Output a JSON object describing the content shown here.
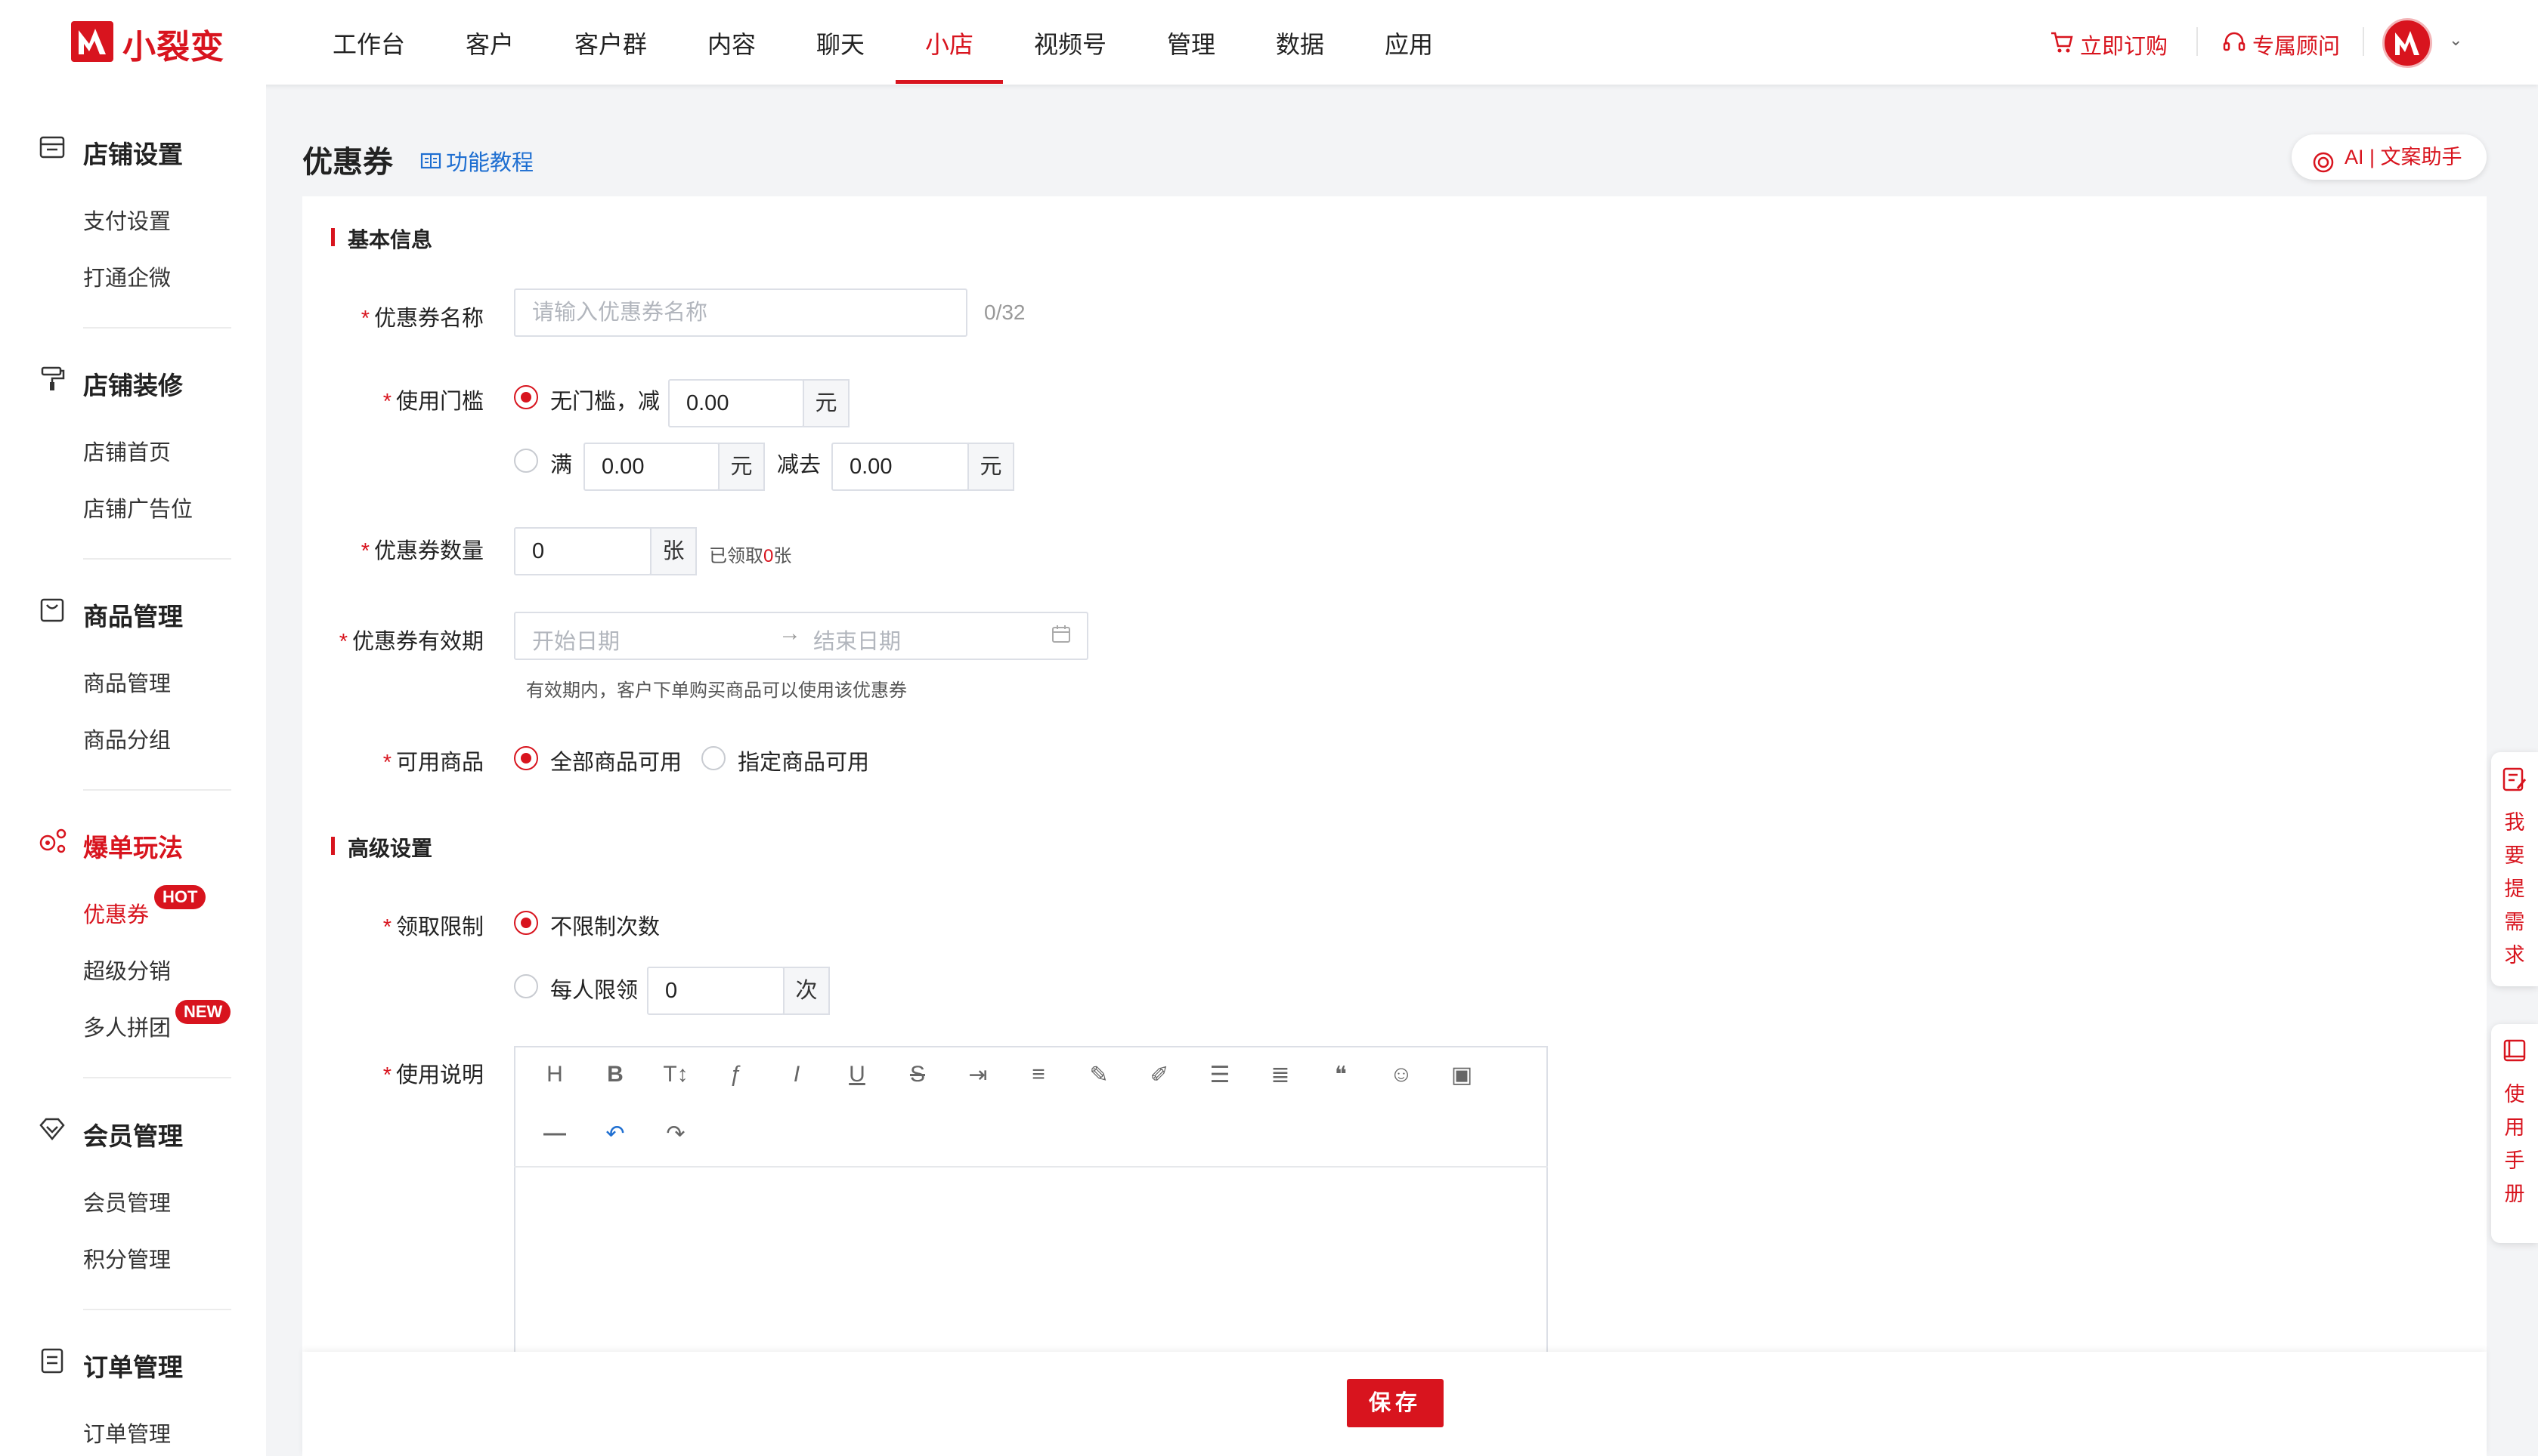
{
  "app": {
    "logo_text": "小裂变"
  },
  "nav": {
    "items": [
      "工作台",
      "客户",
      "客户群",
      "内容",
      "聊天",
      "小店",
      "视频号",
      "管理",
      "数据",
      "应用"
    ],
    "active": "小店"
  },
  "header_actions": {
    "order": "立即订购",
    "consultant": "专属顾问"
  },
  "sidebar": {
    "sections": [
      {
        "title": "店铺设置",
        "items": [
          "支付设置",
          "打通企微"
        ]
      },
      {
        "title": "店铺装修",
        "items": [
          "店铺首页",
          "店铺广告位"
        ]
      },
      {
        "title": "商品管理",
        "items": [
          "商品管理",
          "商品分组"
        ]
      },
      {
        "title": "爆单玩法",
        "items": [
          "优惠券",
          "超级分销",
          "多人拼团"
        ]
      },
      {
        "title": "会员管理",
        "items": [
          "会员管理",
          "积分管理"
        ]
      },
      {
        "title": "订单管理",
        "items": [
          "订单管理"
        ]
      }
    ],
    "badges": {
      "hot": "HOT",
      "new": "NEW"
    }
  },
  "page": {
    "title": "优惠券",
    "tutorial": "功能教程",
    "ai_button": "AI | 文案助手"
  },
  "basic": {
    "section_title": "基本信息",
    "name_label": "优惠券名称",
    "name_placeholder": "请输入优惠券名称",
    "name_counter": "0/32",
    "threshold_label": "使用门槛",
    "threshold_opt1": "无门槛，减",
    "threshold_opt1_value": "0.00",
    "threshold_opt2_prefix": "满",
    "threshold_opt2_value1": "0.00",
    "threshold_opt2_mid": "减去",
    "threshold_opt2_value2": "0.00",
    "unit_yuan": "元",
    "quantity_label": "优惠券数量",
    "quantity_value": "0",
    "unit_zhang": "张",
    "claimed_prefix": "已领取",
    "claimed_count": "0",
    "claimed_suffix": "张",
    "validity_label": "优惠券有效期",
    "start_placeholder": "开始日期",
    "end_placeholder": "结束日期",
    "validity_hint": "有效期内，客户下单购买商品可以使用该优惠券",
    "goods_label": "可用商品",
    "goods_opt1": "全部商品可用",
    "goods_opt2": "指定商品可用"
  },
  "advanced": {
    "section_title": "高级设置",
    "limit_label": "领取限制",
    "limit_opt1": "不限制次数",
    "limit_opt2": "每人限领",
    "limit_value": "0",
    "unit_ci": "次",
    "desc_label": "使用说明"
  },
  "editor_tools": [
    "H",
    "B",
    "T↕",
    "ƒ",
    "I",
    "U",
    "S",
    "⇥",
    "≡",
    "✎",
    "✐",
    "☰",
    "≣",
    "❝",
    "☺",
    "▣",
    "—",
    "↶",
    "↷"
  ],
  "footer": {
    "save": "保存"
  },
  "floaters": {
    "request": [
      "我",
      "要",
      "提",
      "需",
      "求"
    ],
    "manual": [
      "使",
      "用",
      "手",
      "册"
    ]
  },
  "colors": {
    "brand": "#d8141e",
    "link": "#1f6fd1"
  }
}
